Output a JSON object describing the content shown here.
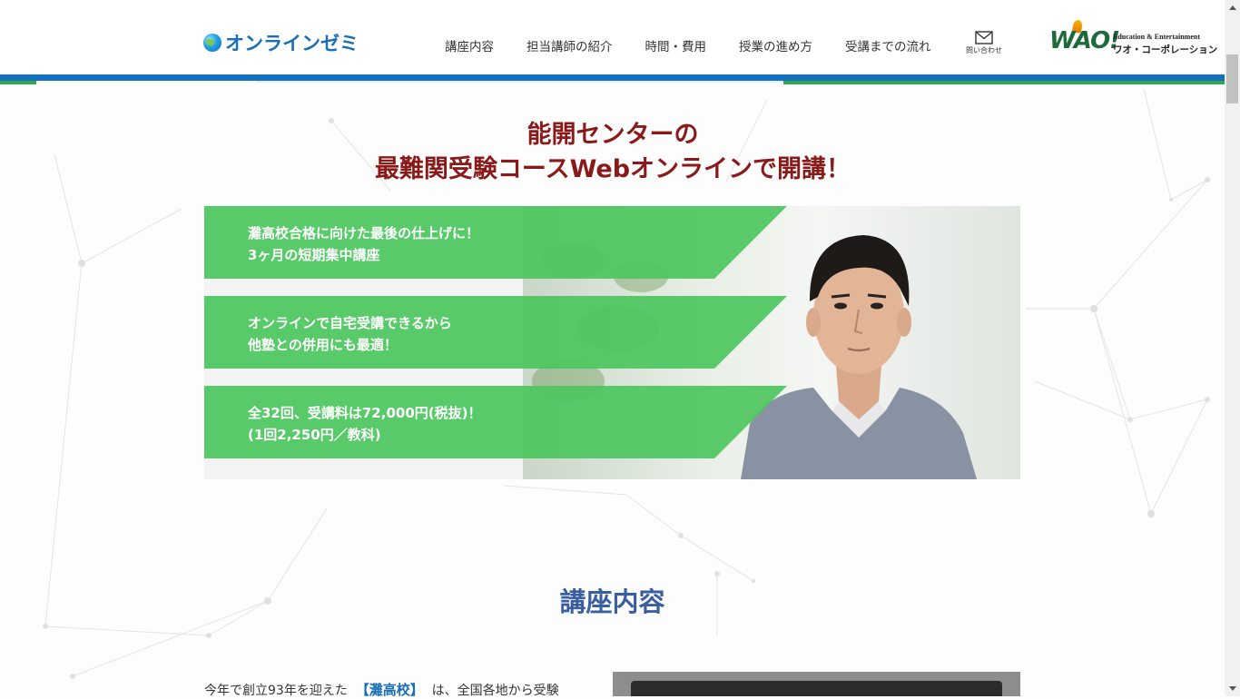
{
  "header": {
    "logo_text": "オンラインゼミ",
    "nav": [
      {
        "label": "講座内容"
      },
      {
        "label": "担当講師の紹介"
      },
      {
        "label": "時間・費用"
      },
      {
        "label": "授業の進め方"
      },
      {
        "label": "受講までの流れ"
      }
    ],
    "contact_label": "問い合わせ",
    "brand_mark": "WAO!",
    "brand_en": "Education & Entertainment",
    "brand_jp": "ワオ・コーポレーション"
  },
  "hero": {
    "title_line1": "能開センターの",
    "title_line2": "最難関受験コースWebオンラインで開講！",
    "points": [
      {
        "line1": "灘高校合格に向けた最後の仕上げに！",
        "line2": "3ヶ月の短期集中講座"
      },
      {
        "line1": "オンラインで自宅受講できるから",
        "line2": "他塾との併用にも最適！"
      },
      {
        "line1": "全32回、受講料は72,000円(税抜)！",
        "line2": "(1回2,250円／教科)"
      }
    ]
  },
  "section": {
    "title": "講座内容",
    "intro_prefix": "今年で創立93年を迎えた",
    "intro_highlight": "【灘高校】",
    "intro_suffix": "は、全国各地から受験"
  },
  "colors": {
    "accent_blue": "#1470c0",
    "accent_green": "#2faa4a",
    "band_green": "#4cc65e",
    "title_red": "#8a1a1a",
    "section_blue": "#3a5fa0"
  }
}
